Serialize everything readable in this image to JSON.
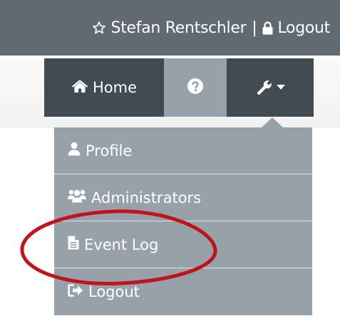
{
  "header": {
    "user_name": "Stefan Rentschler",
    "separator": "|",
    "logout_label": "Logout",
    "user_icon": "star-icon",
    "logout_icon": "lock-icon"
  },
  "nav": {
    "home_label": "Home",
    "home_icon": "home-icon",
    "help_icon": "question-circle-icon",
    "tools_icon": "wrench-icon",
    "tools_caret_icon": "caret-down-icon"
  },
  "menu": {
    "items": [
      {
        "label": "Profile",
        "icon": "user-icon"
      },
      {
        "label": "Administrators",
        "icon": "users-icon"
      },
      {
        "label": "Event Log",
        "icon": "file-text-icon"
      },
      {
        "label": "Logout",
        "icon": "sign-out-icon"
      }
    ]
  },
  "colors": {
    "topbar": "#5f6a72",
    "nav_dark": "#414b52",
    "nav_active": "#97a1a9",
    "annotation": "#c0141c"
  }
}
